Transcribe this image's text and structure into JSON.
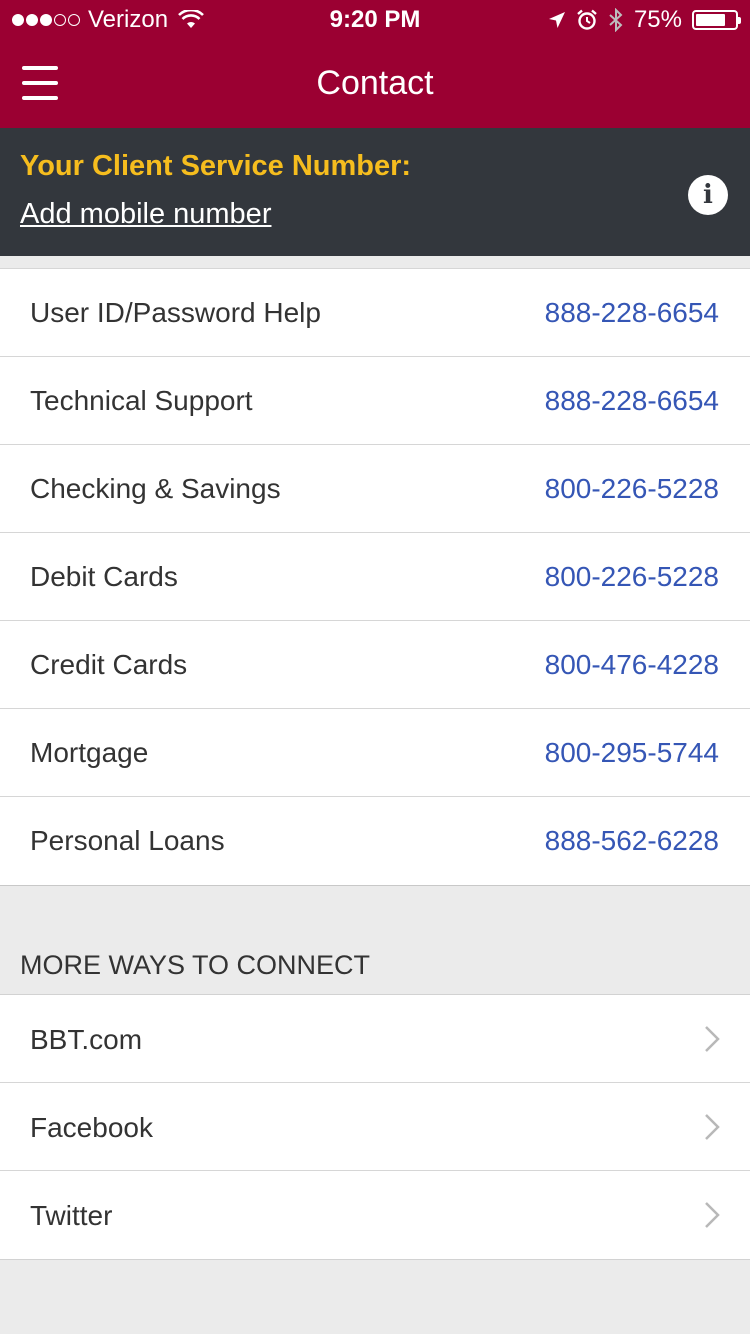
{
  "status_bar": {
    "carrier": "Verizon",
    "time": "9:20 PM",
    "battery": "75%",
    "battery_level": 0.75,
    "signal_bars_filled": 3,
    "signal_bars_total": 5
  },
  "nav": {
    "title": "Contact",
    "menu_icon": "hamburger-menu-icon"
  },
  "client_banner": {
    "label": "Your Client Service Number:",
    "link": "Add mobile number",
    "info_icon": "info-icon"
  },
  "contacts": [
    {
      "name": "User ID/Password Help",
      "phone": "888-228-6654"
    },
    {
      "name": "Technical Support",
      "phone": "888-228-6654"
    },
    {
      "name": "Checking & Savings",
      "phone": "800-226-5228"
    },
    {
      "name": "Debit Cards",
      "phone": "800-226-5228"
    },
    {
      "name": "Credit Cards",
      "phone": "800-476-4228"
    },
    {
      "name": "Mortgage",
      "phone": "800-295-5744"
    },
    {
      "name": "Personal Loans",
      "phone": "888-562-6228"
    }
  ],
  "more": {
    "header": "MORE WAYS TO CONNECT",
    "items": [
      {
        "label": "BBT.com"
      },
      {
        "label": "Facebook"
      },
      {
        "label": "Twitter"
      }
    ]
  },
  "colors": {
    "brand": "#9b0032",
    "banner_bg": "#33373d",
    "accent_yellow": "#f6bd1e",
    "phone_link": "#3556b5"
  }
}
